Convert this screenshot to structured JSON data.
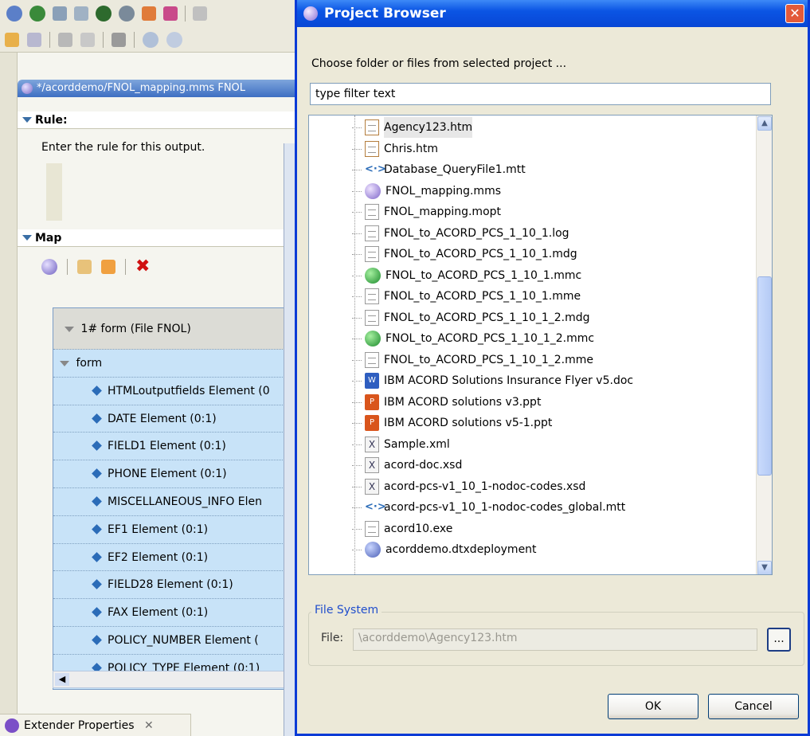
{
  "background_editor": {
    "editor_tab_title": "*/acorddemo/FNOL_mapping.mms FNOL",
    "rule_section": {
      "title": "Rule:",
      "description": "Enter the rule for this output."
    },
    "map_section": {
      "title": "Map"
    },
    "tree": {
      "header": "1# form (File FNOL)",
      "root": "form",
      "elements": [
        "HTMLoutputfields Element (0",
        "DATE Element (0:1)",
        "FIELD1 Element (0:1)",
        "PHONE Element (0:1)",
        "MISCELLANEOUS_INFO Elen",
        "EF1 Element (0:1)",
        "EF2 Element (0:1)",
        "FIELD28 Element (0:1)",
        "FAX Element (0:1)",
        "POLICY_NUMBER Element (",
        "POLICY_TYPE Element (0:1)"
      ]
    },
    "bottom_tab": "Extender Properties"
  },
  "dialog": {
    "title": "Project Browser",
    "prompt": "Choose folder or files from selected project ...",
    "filter_value": "type filter text",
    "files": [
      {
        "name": "Agency123.htm",
        "icon": "htm",
        "selected": true
      },
      {
        "name": "Chris.htm",
        "icon": "htm"
      },
      {
        "name": "Database_QueryFile1.mtt",
        "icon": "mtt"
      },
      {
        "name": "FNOL_mapping.mms",
        "icon": "mms"
      },
      {
        "name": "FNOL_mapping.mopt",
        "icon": "doc"
      },
      {
        "name": "FNOL_to_ACORD_PCS_1_10_1.log",
        "icon": "doc"
      },
      {
        "name": "FNOL_to_ACORD_PCS_1_10_1.mdg",
        "icon": "doc"
      },
      {
        "name": "FNOL_to_ACORD_PCS_1_10_1.mmc",
        "icon": "mmc"
      },
      {
        "name": "FNOL_to_ACORD_PCS_1_10_1.mme",
        "icon": "doc"
      },
      {
        "name": "FNOL_to_ACORD_PCS_1_10_1_2.mdg",
        "icon": "doc"
      },
      {
        "name": "FNOL_to_ACORD_PCS_1_10_1_2.mmc",
        "icon": "mmc"
      },
      {
        "name": "FNOL_to_ACORD_PCS_1_10_1_2.mme",
        "icon": "doc"
      },
      {
        "name": "IBM ACORD Solutions Insurance Flyer v5.doc",
        "icon": "word"
      },
      {
        "name": "IBM ACORD solutions v3.ppt",
        "icon": "ppt"
      },
      {
        "name": "IBM ACORD solutions v5-1.ppt",
        "icon": "ppt"
      },
      {
        "name": "Sample.xml",
        "icon": "xml"
      },
      {
        "name": "acord-doc.xsd",
        "icon": "xml"
      },
      {
        "name": "acord-pcs-v1_10_1-nodoc-codes.xsd",
        "icon": "xml"
      },
      {
        "name": "acord-pcs-v1_10_1-nodoc-codes_global.mtt",
        "icon": "mtt"
      },
      {
        "name": "acord10.exe",
        "icon": "doc"
      },
      {
        "name": "acorddemo.dtxdeployment",
        "icon": "deploy"
      }
    ],
    "file_system": {
      "legend": "File System",
      "label": "File:",
      "value": "\\acorddemo\\Agency123.htm",
      "browse_label": "..."
    },
    "buttons": {
      "ok": "OK",
      "cancel": "Cancel"
    }
  }
}
